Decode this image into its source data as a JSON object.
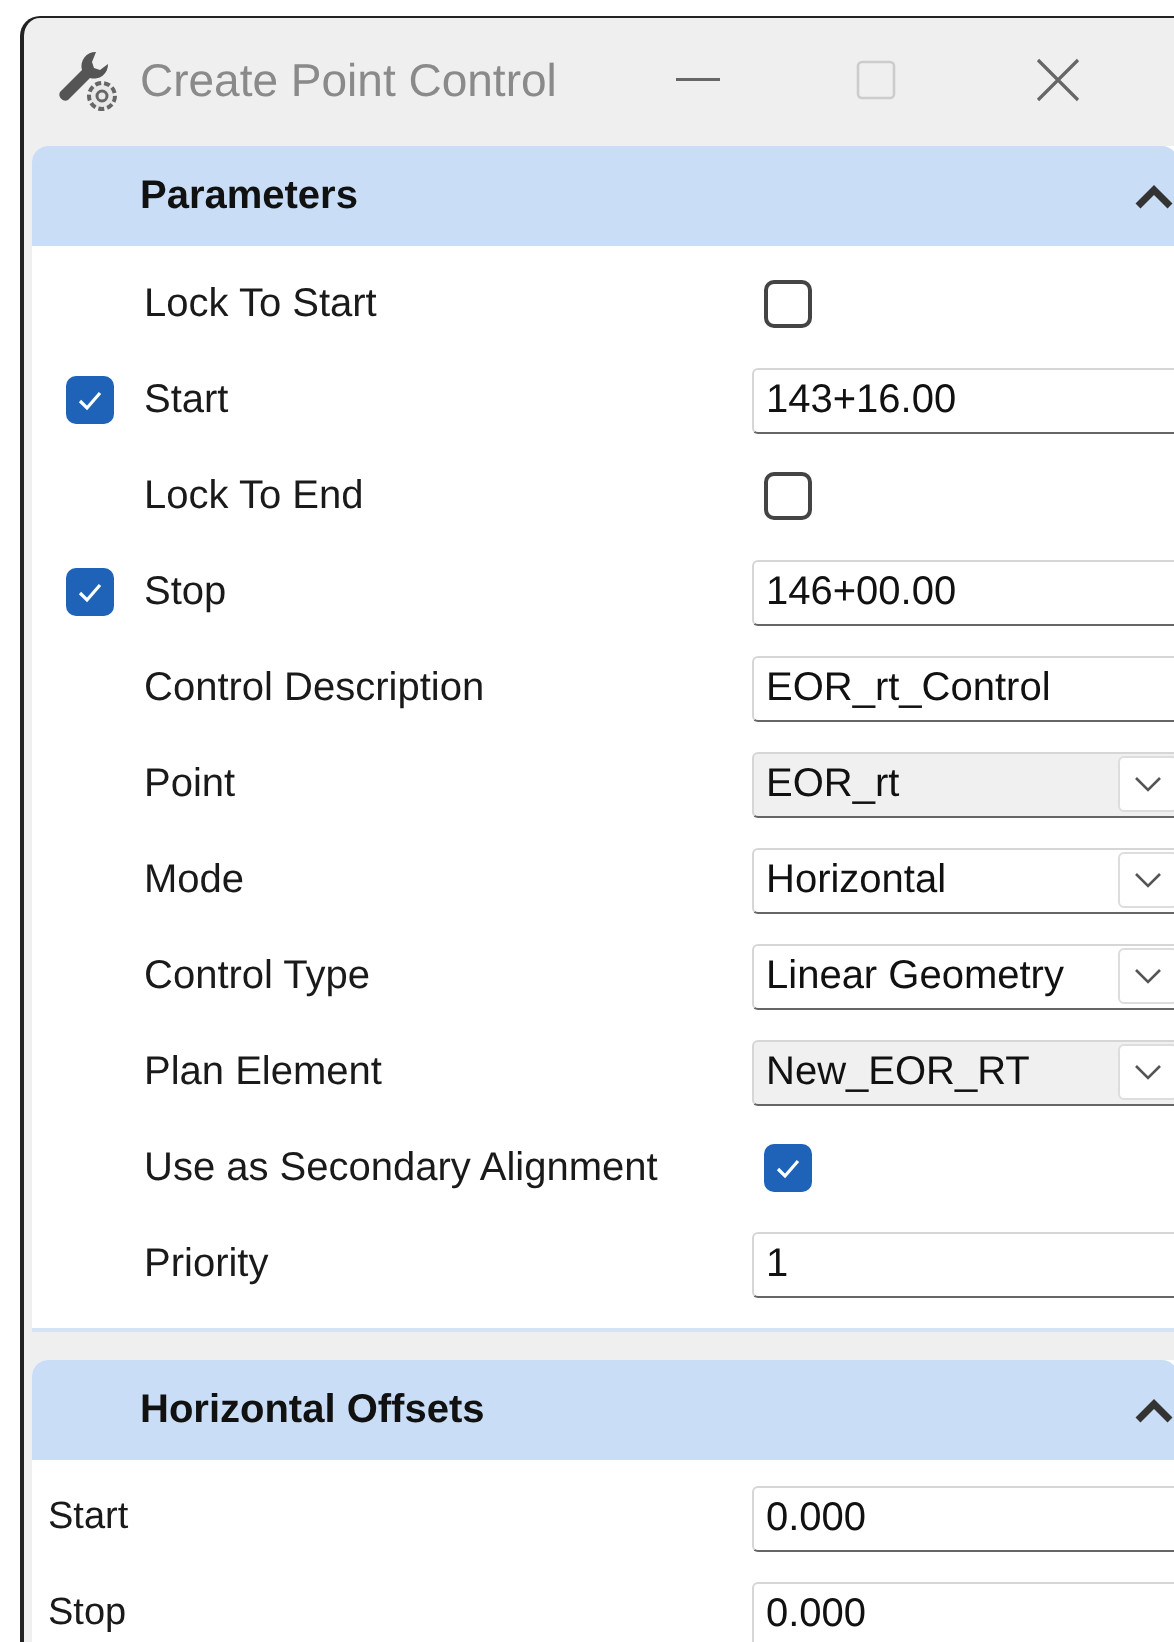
{
  "window": {
    "title": "Create Point Control"
  },
  "sections": [
    {
      "title": "Parameters",
      "expanded": true,
      "indent": true,
      "rows": [
        {
          "label": "Lock To Start",
          "kind": "checkbox",
          "checked": false
        },
        {
          "label": "Start",
          "kind": "text",
          "value": "143+16.00",
          "lead_checked": true
        },
        {
          "label": "Lock To End",
          "kind": "checkbox",
          "checked": false
        },
        {
          "label": "Stop",
          "kind": "text",
          "value": "146+00.00",
          "lead_checked": true
        },
        {
          "label": "Control Description",
          "kind": "text",
          "value": "EOR_rt_Control"
        },
        {
          "label": "Point",
          "kind": "dropdown",
          "value": "EOR_rt",
          "shaded": true
        },
        {
          "label": "Mode",
          "kind": "dropdown",
          "value": "Horizontal",
          "shaded": false
        },
        {
          "label": "Control Type",
          "kind": "dropdown",
          "value": "Linear Geometry",
          "shaded": false
        },
        {
          "label": "Plan Element",
          "kind": "dropdown",
          "value": "New_EOR_RT",
          "shaded": true
        },
        {
          "label": "Use as Secondary Alignment",
          "kind": "checkbox",
          "checked": true
        },
        {
          "label": "Priority",
          "kind": "text",
          "value": "1"
        }
      ]
    },
    {
      "title": "Horizontal Offsets",
      "expanded": true,
      "indent": false,
      "rows": [
        {
          "label": "Start",
          "kind": "text",
          "value": "0.000"
        },
        {
          "label": "Stop",
          "kind": "text",
          "value": "0.000"
        }
      ]
    }
  ]
}
